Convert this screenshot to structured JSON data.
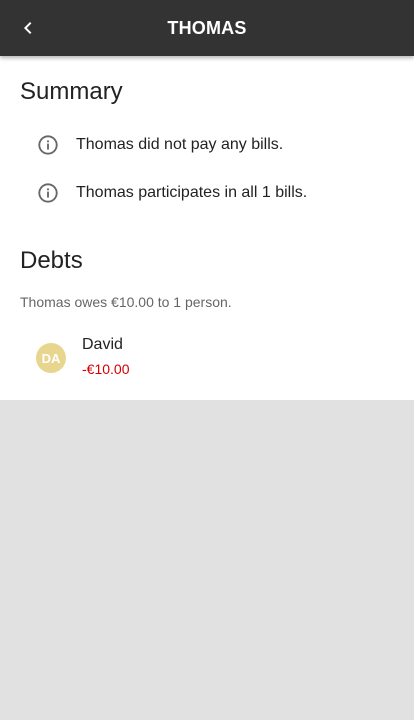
{
  "appbar": {
    "title": "THOMAS",
    "back_icon": "chevron-left-icon"
  },
  "summary": {
    "title": "Summary",
    "items": [
      {
        "icon": "info-icon",
        "text": "Thomas did not pay any bills."
      },
      {
        "icon": "info-icon",
        "text": "Thomas participates in all 1 bills."
      }
    ]
  },
  "debts": {
    "title": "Debts",
    "description": "Thomas owes €10.00 to 1 person.",
    "items": [
      {
        "initials": "DA",
        "name": "David",
        "amount": "-€10.00"
      }
    ]
  },
  "colors": {
    "appbar": "#333333",
    "avatar": "#e8d68f",
    "negative_amount": "#d50000",
    "background": "#e1e1e1"
  }
}
